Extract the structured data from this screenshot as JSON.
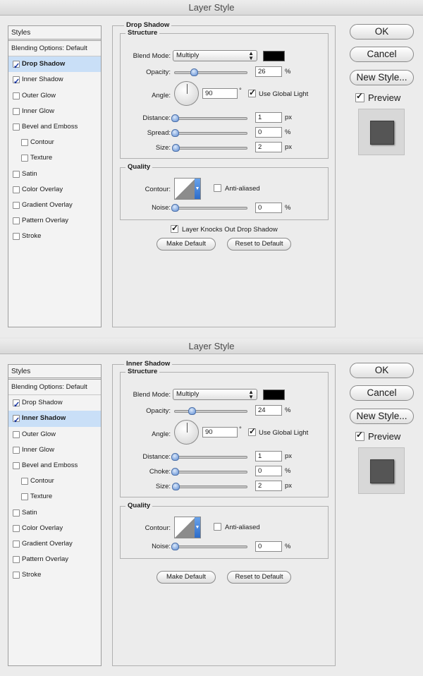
{
  "dialogs": [
    {
      "title": "Layer Style",
      "styles_header": "Styles",
      "styles": [
        {
          "label": "Blending Options: Default",
          "type": "blend",
          "checked": false,
          "selected": false
        },
        {
          "label": "Drop Shadow",
          "type": "item",
          "checked": true,
          "selected": true
        },
        {
          "label": "Inner Shadow",
          "type": "item",
          "checked": true,
          "selected": false
        },
        {
          "label": "Outer Glow",
          "type": "item",
          "checked": false,
          "selected": false
        },
        {
          "label": "Inner Glow",
          "type": "item",
          "checked": false,
          "selected": false
        },
        {
          "label": "Bevel and Emboss",
          "type": "item",
          "checked": false,
          "selected": false
        },
        {
          "label": "Contour",
          "type": "sub",
          "checked": false,
          "selected": false
        },
        {
          "label": "Texture",
          "type": "sub",
          "checked": false,
          "selected": false
        },
        {
          "label": "Satin",
          "type": "item",
          "checked": false,
          "selected": false
        },
        {
          "label": "Color Overlay",
          "type": "item",
          "checked": false,
          "selected": false
        },
        {
          "label": "Gradient Overlay",
          "type": "item",
          "checked": false,
          "selected": false
        },
        {
          "label": "Pattern Overlay",
          "type": "item",
          "checked": false,
          "selected": false
        },
        {
          "label": "Stroke",
          "type": "item",
          "checked": false,
          "selected": false
        }
      ],
      "section_title": "Drop Shadow",
      "structure": {
        "title": "Structure",
        "blend_mode_label": "Blend Mode:",
        "blend_mode": "Multiply",
        "shadow_color": "#000000",
        "opacity_label": "Opacity:",
        "opacity": "26",
        "opacity_unit": "%",
        "angle_label": "Angle:",
        "angle": "90",
        "angle_unit": "°",
        "use_global_light_label": "Use Global Light",
        "use_global_light": true,
        "distance_label": "Distance:",
        "distance": "1",
        "distance_unit": "px",
        "third_label": "Spread:",
        "third_value": "0",
        "third_unit": "%",
        "size_label": "Size:",
        "size": "2",
        "size_unit": "px"
      },
      "quality": {
        "title": "Quality",
        "contour_label": "Contour:",
        "anti_aliased_label": "Anti-aliased",
        "anti_aliased": false,
        "noise_label": "Noise:",
        "noise": "0",
        "noise_unit": "%"
      },
      "knockout_label": "Layer Knocks Out Drop Shadow",
      "knockout": true,
      "show_knockout": true,
      "make_default": "Make Default",
      "reset_default": "Reset to Default",
      "ok": "OK",
      "cancel": "Cancel",
      "new_style": "New Style...",
      "preview_label": "Preview",
      "preview": true
    },
    {
      "title": "Layer Style",
      "styles_header": "Styles",
      "styles": [
        {
          "label": "Blending Options: Default",
          "type": "blend",
          "checked": false,
          "selected": false
        },
        {
          "label": "Drop Shadow",
          "type": "item",
          "checked": true,
          "selected": false
        },
        {
          "label": "Inner Shadow",
          "type": "item",
          "checked": true,
          "selected": true
        },
        {
          "label": "Outer Glow",
          "type": "item",
          "checked": false,
          "selected": false
        },
        {
          "label": "Inner Glow",
          "type": "item",
          "checked": false,
          "selected": false
        },
        {
          "label": "Bevel and Emboss",
          "type": "item",
          "checked": false,
          "selected": false
        },
        {
          "label": "Contour",
          "type": "sub",
          "checked": false,
          "selected": false
        },
        {
          "label": "Texture",
          "type": "sub",
          "checked": false,
          "selected": false
        },
        {
          "label": "Satin",
          "type": "item",
          "checked": false,
          "selected": false
        },
        {
          "label": "Color Overlay",
          "type": "item",
          "checked": false,
          "selected": false
        },
        {
          "label": "Gradient Overlay",
          "type": "item",
          "checked": false,
          "selected": false
        },
        {
          "label": "Pattern Overlay",
          "type": "item",
          "checked": false,
          "selected": false
        },
        {
          "label": "Stroke",
          "type": "item",
          "checked": false,
          "selected": false
        }
      ],
      "section_title": "Inner Shadow",
      "structure": {
        "title": "Structure",
        "blend_mode_label": "Blend Mode:",
        "blend_mode": "Multiply",
        "shadow_color": "#000000",
        "opacity_label": "Opacity:",
        "opacity": "24",
        "opacity_unit": "%",
        "angle_label": "Angle:",
        "angle": "90",
        "angle_unit": "°",
        "use_global_light_label": "Use Global Light",
        "use_global_light": true,
        "distance_label": "Distance:",
        "distance": "1",
        "distance_unit": "px",
        "third_label": "Choke:",
        "third_value": "0",
        "third_unit": "%",
        "size_label": "Size:",
        "size": "2",
        "size_unit": "px"
      },
      "quality": {
        "title": "Quality",
        "contour_label": "Contour:",
        "anti_aliased_label": "Anti-aliased",
        "anti_aliased": false,
        "noise_label": "Noise:",
        "noise": "0",
        "noise_unit": "%"
      },
      "knockout_label": "",
      "knockout": false,
      "show_knockout": false,
      "make_default": "Make Default",
      "reset_default": "Reset to Default",
      "ok": "OK",
      "cancel": "Cancel",
      "new_style": "New Style...",
      "preview_label": "Preview",
      "preview": true
    }
  ]
}
